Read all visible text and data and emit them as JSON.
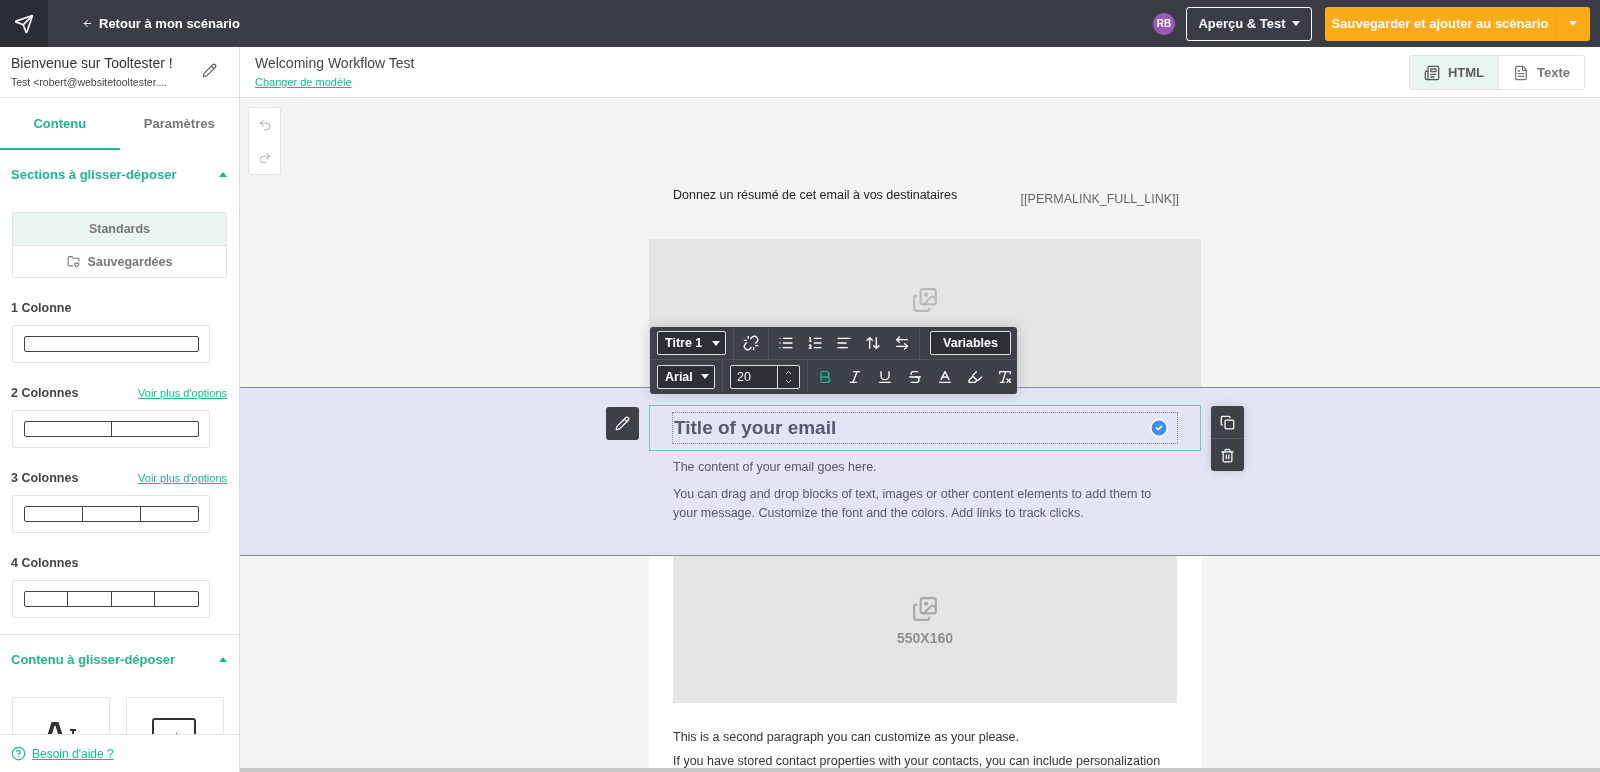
{
  "topbar": {
    "back_link": "Retour à mon scénario",
    "avatar": "RB",
    "preview_button": "Aperçu & Test",
    "save_button": "Sauvegarder et ajouter au scénario"
  },
  "campaign": {
    "title": "Bienvenue sur Tooltester !",
    "sender": "Test <robert@websitetooltester...."
  },
  "template": {
    "name": "Welcoming Workflow Test",
    "change_link": "Changer de modèle"
  },
  "view_modes": [
    {
      "kind": "html",
      "label": "HTML",
      "selected": true
    },
    {
      "kind": "text",
      "label": "Texte",
      "selected": false
    }
  ],
  "sidebar": {
    "tabs": [
      {
        "label": "Contenu",
        "selected": true
      },
      {
        "label": "Paramètres",
        "selected": false
      }
    ],
    "sections_panel": {
      "title": "Sections à glisser-déposer",
      "expanded": true,
      "segments": [
        {
          "label": "Standards",
          "selected": true
        },
        {
          "label": "Sauvegardées",
          "selected": false
        }
      ],
      "layouts": [
        {
          "label": "1 Colonne",
          "kind": "single"
        },
        {
          "label": "2 Colonnes",
          "kind": "double",
          "more_link": "Voir plus d'options"
        },
        {
          "label": "3 Colonnes",
          "kind": "triple",
          "more_link": "Voir plus d'options"
        },
        {
          "label": "4 Colonnes",
          "kind": "quad"
        }
      ]
    },
    "content_panel": {
      "title": "Contenu à glisser-déposer",
      "expanded": true,
      "tiles": [
        {
          "kind": "text"
        },
        {
          "kind": "button"
        }
      ]
    },
    "help_link": "Besoin d'aide ?"
  },
  "editor": {
    "history": {
      "undo_disabled": true,
      "redo_disabled": true
    },
    "preheader": "Donnez un résumé de cet email à vos destinataires",
    "permalink": "[[PERMALINK_FULL_LINK]]",
    "toolbar": {
      "block_style": "Titre 1",
      "variables_button": "Variables",
      "font": "Arial",
      "font_size": "20",
      "formats": [
        {
          "kind": "bold",
          "active": true
        },
        {
          "kind": "italic",
          "active": false
        },
        {
          "kind": "underline",
          "active": false
        },
        {
          "kind": "strike",
          "active": false
        },
        {
          "kind": "color",
          "active": false
        },
        {
          "kind": "highlight",
          "active": false
        },
        {
          "kind": "clear",
          "active": false
        }
      ]
    },
    "title": "Title of your email",
    "paragraphs": [
      "The content of your email goes here.",
      "You can drag and drop blocks of text, images or other content elements to add them to your message. Customize the font and the colors. Add links to track clicks."
    ],
    "image_size": "550X160",
    "second_paragraphs": [
      "This is a second paragraph you can customize as your please.",
      "If you have stored contact properties with your contacts, you can include personalization"
    ]
  }
}
